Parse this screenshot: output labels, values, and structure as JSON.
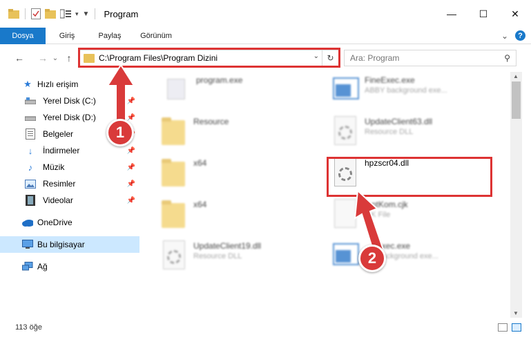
{
  "window": {
    "title": "Program"
  },
  "window_controls": {
    "minimize": "—",
    "maximize": "☐",
    "close": "✕"
  },
  "ribbon": {
    "tabs": [
      "Dosya",
      "Giriş",
      "Paylaş",
      "Görünüm"
    ],
    "expand": "⌄",
    "help": "?"
  },
  "nav": {
    "back": "←",
    "forward": "→",
    "dropdown": "⌄",
    "up": "↑",
    "address": "C:\\Program Files\\Program Dizini",
    "address_dropdown": "⌄",
    "refresh": "↻",
    "search_placeholder": "Ara: Program",
    "search_icon": "⚲"
  },
  "sidebar": {
    "quick_access": "Hızlı erişim",
    "items": [
      {
        "label": "Yerel Disk (C:)",
        "icon": "drive-icon",
        "pinned": true
      },
      {
        "label": "Yerel Disk (D:)",
        "icon": "drive-icon",
        "pinned": true
      },
      {
        "label": "Belgeler",
        "icon": "documents-icon",
        "pinned": true
      },
      {
        "label": "İndirmeler",
        "icon": "downloads-icon",
        "pinned": true
      },
      {
        "label": "Müzik",
        "icon": "music-icon",
        "pinned": true
      },
      {
        "label": "Resimler",
        "icon": "pictures-icon",
        "pinned": true
      },
      {
        "label": "Videolar",
        "icon": "videos-icon",
        "pinned": true
      }
    ],
    "onedrive": "OneDrive",
    "this_pc": "Bu bilgisayar",
    "network": "Ağ"
  },
  "files": [
    {
      "name": "program.exe",
      "desc": ""
    },
    {
      "name": "FineExec.exe",
      "desc": "ABBY background exe..."
    },
    {
      "name": "Resource",
      "desc": ""
    },
    {
      "name": "UpdateClient63.dll",
      "desc": "Resource DLL"
    },
    {
      "name": "x64",
      "desc": ""
    },
    {
      "name": "hpzscr04.dll",
      "desc": ""
    },
    {
      "name": "x64",
      "desc": ""
    },
    {
      "name": "...ntKom.cjk",
      "desc": "...K File"
    },
    {
      "name": "UpdateClient19.dll",
      "desc": "Resource DLL"
    },
    {
      "name": "...eExec.exe",
      "desc": "...Y background exe..."
    }
  ],
  "annotations": {
    "step1": "1",
    "step2": "2"
  },
  "status": {
    "count": "113 öğe"
  },
  "colors": {
    "accent": "#1979ca",
    "highlight": "#dd3333",
    "selected": "#cce8ff"
  }
}
